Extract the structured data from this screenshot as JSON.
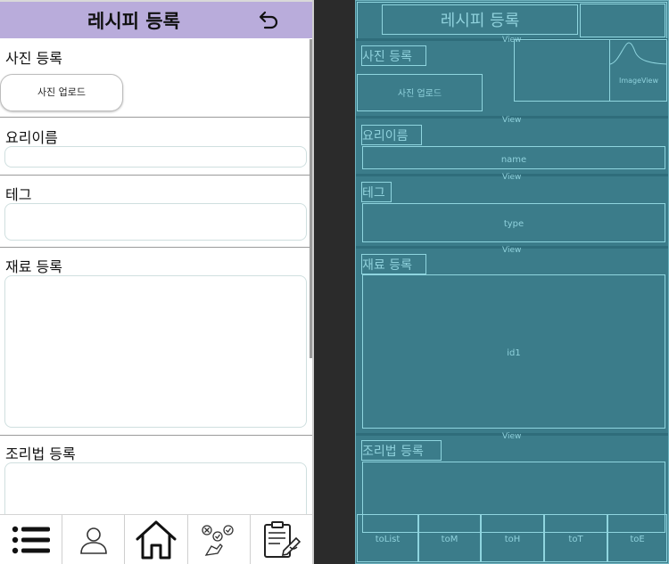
{
  "preview": {
    "title": "레시피 등록",
    "sections": {
      "photo": "사진 등록",
      "upload_button": "사진 업로드",
      "name": "요리이름",
      "tag": "테그",
      "ingredients": "재료 등록",
      "recipe": "조리법 등록"
    },
    "icons": {
      "back": "undo-arrow-icon",
      "nav": [
        "list-icon",
        "user-icon",
        "home-icon",
        "checklist-icon",
        "recipe-board-icon"
      ]
    },
    "colors": {
      "header": "#b9acdb",
      "blueprint": "#3b7c8a",
      "blueprint_line": "#8fd5df"
    }
  },
  "blueprint": {
    "title": "레시피 등록",
    "view_label": "View",
    "photo_label": "사진 등록",
    "upload_label": "사진 업로드",
    "imageview_label": "ImageView",
    "name_label": "요리이름",
    "name_id": "name",
    "tag_label": "테그",
    "tag_id": "type",
    "ingredients_label": "재료 등록",
    "ingredients_id": "id1",
    "recipe_label": "조리법 등록",
    "nav_ids": [
      "toList",
      "toM",
      "toH",
      "toT",
      "toE"
    ]
  }
}
